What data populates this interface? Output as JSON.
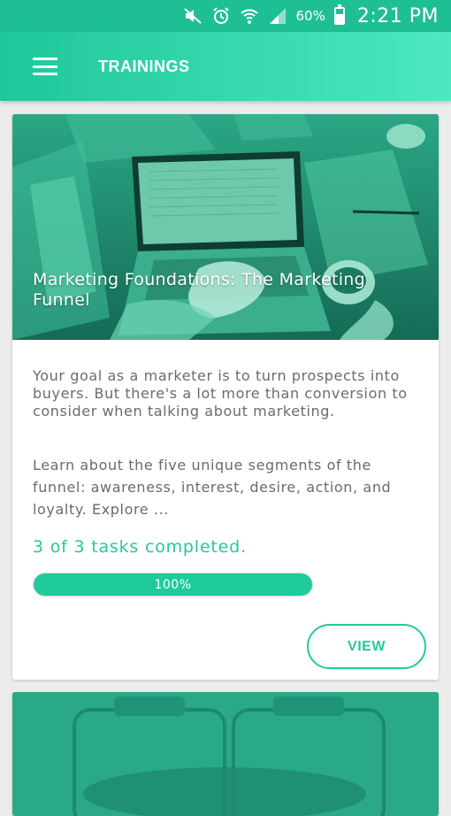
{
  "status_bar": {
    "battery_percent": "60%",
    "time": "2:21 PM",
    "icons": [
      "mute-icon",
      "alarm-icon",
      "wifi-icon",
      "signal-icon",
      "battery-icon"
    ]
  },
  "app_bar": {
    "title": "TRAININGS",
    "menu_icon": "hamburger-menu-icon"
  },
  "trainings": [
    {
      "title": "Marketing Foundations: The Marketing Funnel",
      "description": "Your goal as a marketer is to turn prospects into buyers. But there's a lot more than conversion to consider when talking about marketing.",
      "description_more": "Learn about the five unique segments of the funnel: awareness, interest, desire, action, and loyalty. Explore ...",
      "tasks_text": "3 of 3 tasks completed.",
      "progress_percent": 100,
      "progress_label": "100%",
      "action_label": "VIEW"
    }
  ],
  "colors": {
    "accent": "#25c99c",
    "app_bar_start": "#1fc79a",
    "app_bar_end": "#4de8c0",
    "image_tint": "#1f8f72"
  }
}
